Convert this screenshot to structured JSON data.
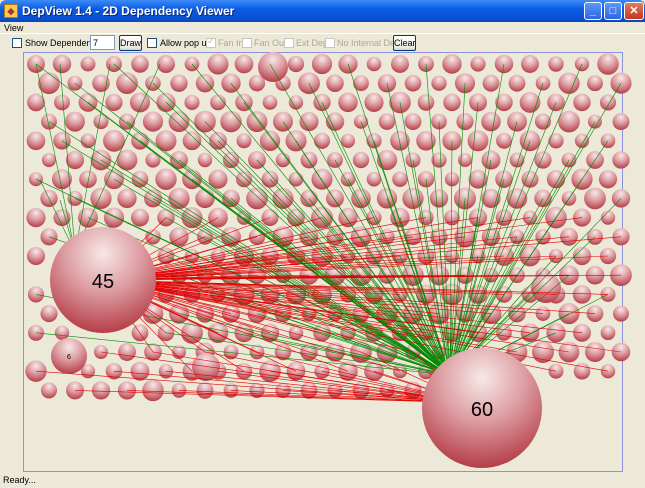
{
  "window": {
    "title": "DepView 1.4 - 2D Dependency Viewer",
    "minimize_glyph": "_",
    "maximize_glyph": "□",
    "close_glyph": "✕"
  },
  "menu": {
    "items": [
      "View"
    ]
  },
  "toolbar": {
    "show_dependency_label": "Show Dependency",
    "show_dependency_checked": false,
    "depth_value": "7",
    "draw_label": "Draw",
    "allow_popup_label": "Allow pop up",
    "allow_popup_checked": false,
    "fan_in_label": "Fan In",
    "fan_in_checked": true,
    "fan_out_label": "Fan Out",
    "fan_out_checked": false,
    "ext_dep_label": "Ext Dep",
    "ext_dep_checked": false,
    "no_internal_dep_label": "No Internal Dep",
    "no_internal_dep_checked": false,
    "clear_label": "Clear"
  },
  "graph": {
    "big_nodes": [
      {
        "label": "45",
        "size": 45
      },
      {
        "label": "60",
        "size": 60
      },
      {
        "label": "6",
        "size": 6
      }
    ],
    "fan_out_color": "#e00000",
    "fan_in_color": "#008a00",
    "node_color_light": "#f3dcdc",
    "node_color_dark": "#b0323c"
  },
  "status": {
    "text": "Ready..."
  }
}
